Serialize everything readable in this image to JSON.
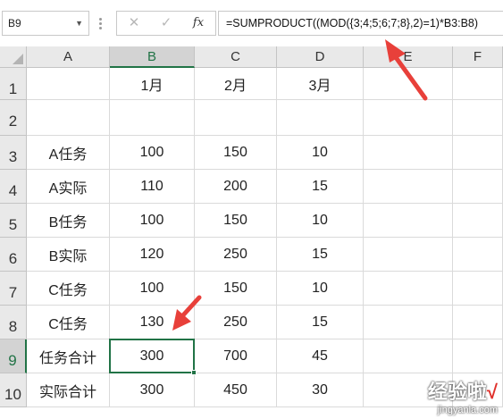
{
  "formula_bar": {
    "name_box": "B9",
    "cancel_icon": "close-icon",
    "enter_icon": "check-icon",
    "function_label": "fx",
    "formula": "=SUMPRODUCT((MOD({3;4;5;6;7;8},2)=1)*B3:B8)"
  },
  "sheet": {
    "columns": [
      "A",
      "B",
      "C",
      "D",
      "E",
      "F"
    ],
    "selected_column": "B",
    "rows": [
      {
        "num": "1",
        "cells": [
          "",
          "1月",
          "2月",
          "3月",
          "",
          ""
        ]
      },
      {
        "num": "2",
        "cells": [
          "",
          "",
          "",
          "",
          "",
          ""
        ]
      },
      {
        "num": "3",
        "cells": [
          "A任务",
          "100",
          "150",
          "10",
          "",
          ""
        ]
      },
      {
        "num": "4",
        "cells": [
          "A实际",
          "110",
          "200",
          "15",
          "",
          ""
        ]
      },
      {
        "num": "5",
        "cells": [
          "B任务",
          "100",
          "150",
          "10",
          "",
          ""
        ]
      },
      {
        "num": "6",
        "cells": [
          "B实际",
          "120",
          "250",
          "15",
          "",
          ""
        ]
      },
      {
        "num": "7",
        "cells": [
          "C任务",
          "100",
          "150",
          "10",
          "",
          ""
        ]
      },
      {
        "num": "8",
        "cells": [
          "C任务",
          "130",
          "250",
          "15",
          "",
          ""
        ]
      },
      {
        "num": "9",
        "cells": [
          "任务合计",
          "300",
          "700",
          "45",
          "",
          ""
        ]
      },
      {
        "num": "10",
        "cells": [
          "实际合计",
          "300",
          "450",
          "30",
          "",
          ""
        ]
      }
    ],
    "selected_row": "9",
    "active_cell": "B9"
  },
  "annotations": {
    "arrow_color": "#e8403a"
  },
  "watermark": {
    "title": "经验啦",
    "check": "√",
    "url": "jingyanla.com"
  },
  "colors": {
    "accent": "#217346",
    "header_bg": "#e9e9e9",
    "header_selected_bg": "#d3d3d3"
  }
}
